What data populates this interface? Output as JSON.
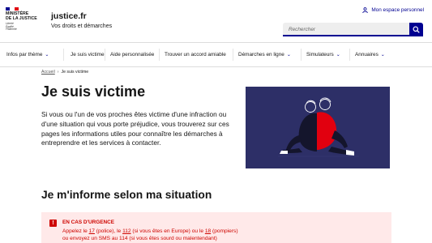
{
  "brand": {
    "logo_lines": [
      "MINISTÈRE",
      "DE LA JUSTICE"
    ],
    "motto": [
      "Liberté",
      "Égalité",
      "Fraternité"
    ],
    "flag_colors": [
      "#000091",
      "#ffffff",
      "#e1000f"
    ],
    "site_title": "justice.fr",
    "site_subtitle": "Vos droits et démarches"
  },
  "header": {
    "account_label": "Mon espace personnel",
    "search_placeholder": "Rechercher",
    "accent_color": "#000091"
  },
  "nav": {
    "items": [
      {
        "label": "Infos par thème",
        "has_menu": true
      },
      {
        "label": "Je suis victime",
        "has_menu": false
      },
      {
        "label": "Aide personnalisée",
        "has_menu": false
      },
      {
        "label": "Trouver un accord amiable",
        "has_menu": false
      },
      {
        "label": "Démarches en ligne",
        "has_menu": true
      },
      {
        "label": "Simulateurs",
        "has_menu": true
      },
      {
        "label": "Annuaires",
        "has_menu": true
      }
    ]
  },
  "breadcrumb": {
    "home": "Accueil",
    "separator": "›",
    "current": "Je suis victime"
  },
  "main": {
    "title": "Je suis victime",
    "intro": "Si vous ou l'un de vos proches êtes victime d'une infraction ou d'une situation qui vous porte préjudice, vous trouverez sur ces pages les informations utiles pour connaître les démarches à entreprendre et les services à contacter.",
    "section_title": "Je m'informe selon ma situation"
  },
  "alert": {
    "icon": "alert-icon",
    "title": "EN CAS D'URGENCE",
    "line1_parts": [
      "Appelez le ",
      "17",
      " (police),  le ",
      "112",
      " (si vous êtes en Europe) ou le ",
      "18",
      " (pompiers)"
    ],
    "line2": "ou envoyez un SMS au 114 (si vous êtes sourd ou malentendant)",
    "color": "#ce0500"
  }
}
